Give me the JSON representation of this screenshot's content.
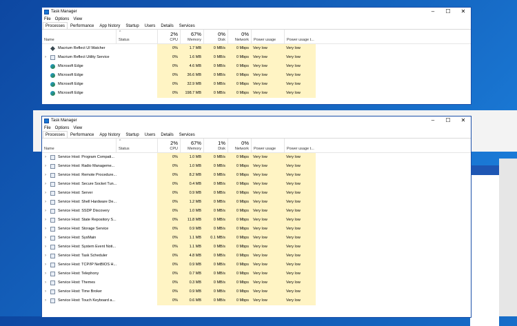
{
  "window1": {
    "title": "Task Manager",
    "menu": [
      "File",
      "Options",
      "View"
    ],
    "tabs": [
      "Processes",
      "Performance",
      "App history",
      "Startup",
      "Users",
      "Details",
      "Services"
    ],
    "active_tab": "Processes",
    "columns": {
      "name": "Name",
      "status": "Status",
      "cpu": {
        "pct": "2%",
        "label": "CPU"
      },
      "memory": {
        "pct": "67%",
        "label": "Memory"
      },
      "disk": {
        "pct": "0%",
        "label": "Disk"
      },
      "network": {
        "pct": "0%",
        "label": "Network"
      },
      "power": "Power usage",
      "power_trend": "Power usage t..."
    },
    "rows": [
      {
        "expand": "",
        "icon": "macrium-icon",
        "name": "Macrium Reflect UI Watcher",
        "cpu": "0%",
        "mem": "1.7 MB",
        "disk": "0 MB/s",
        "net": "0 Mbps",
        "power": "Very low",
        "trend": "Very low"
      },
      {
        "expand": "›",
        "icon": "service-icon",
        "name": "Macrium Reflect Utility Service",
        "cpu": "0%",
        "mem": "1.6 MB",
        "disk": "0 MB/s",
        "net": "0 Mbps",
        "power": "Very low",
        "trend": "Very low"
      },
      {
        "expand": "",
        "icon": "edge-icon",
        "name": "Microsoft Edge",
        "cpu": "0%",
        "mem": "4.6 MB",
        "disk": "0 MB/s",
        "net": "0 Mbps",
        "power": "Very low",
        "trend": "Very low"
      },
      {
        "expand": "",
        "icon": "edge-icon",
        "name": "Microsoft Edge",
        "cpu": "0%",
        "mem": "36.6 MB",
        "disk": "0 MB/s",
        "net": "0 Mbps",
        "power": "Very low",
        "trend": "Very low"
      },
      {
        "expand": "",
        "icon": "edge-icon",
        "name": "Microsoft Edge",
        "cpu": "0%",
        "mem": "32.9 MB",
        "disk": "0 MB/s",
        "net": "0 Mbps",
        "power": "Very low",
        "trend": "Very low"
      },
      {
        "expand": "",
        "icon": "edge-icon",
        "name": "Microsoft Edge",
        "cpu": "0%",
        "mem": "198.7 MB",
        "disk": "0 MB/s",
        "net": "0 Mbps",
        "power": "Very low",
        "trend": "Very low"
      }
    ]
  },
  "window2": {
    "title": "Task Manager",
    "menu": [
      "File",
      "Options",
      "View"
    ],
    "tabs": [
      "Processes",
      "Performance",
      "App history",
      "Startup",
      "Users",
      "Details",
      "Services"
    ],
    "active_tab": "Processes",
    "columns": {
      "name": "Name",
      "status": "Status",
      "cpu": {
        "pct": "2%",
        "label": "CPU"
      },
      "memory": {
        "pct": "67%",
        "label": "Memory"
      },
      "disk": {
        "pct": "1%",
        "label": "Disk"
      },
      "network": {
        "pct": "0%",
        "label": "Network"
      },
      "power": "Power usage",
      "power_trend": "Power usage t..."
    },
    "rows": [
      {
        "expand": "›",
        "icon": "service-icon",
        "name": "Service Host: Program Compati...",
        "cpu": "0%",
        "mem": "1.0 MB",
        "disk": "0 MB/s",
        "net": "0 Mbps",
        "power": "Very low",
        "trend": "Very low"
      },
      {
        "expand": "›",
        "icon": "service-icon",
        "name": "Service Host: Radio Manageme...",
        "cpu": "0%",
        "mem": "1.0 MB",
        "disk": "0 MB/s",
        "net": "0 Mbps",
        "power": "Very low",
        "trend": "Very low"
      },
      {
        "expand": "›",
        "icon": "service-icon",
        "name": "Service Host: Remote Procedure...",
        "cpu": "0%",
        "mem": "8.2 MB",
        "disk": "0 MB/s",
        "net": "0 Mbps",
        "power": "Very low",
        "trend": "Very low"
      },
      {
        "expand": "›",
        "icon": "service-icon",
        "name": "Service Host: Secure Socket Tun...",
        "cpu": "0%",
        "mem": "0.4 MB",
        "disk": "0 MB/s",
        "net": "0 Mbps",
        "power": "Very low",
        "trend": "Very low"
      },
      {
        "expand": "›",
        "icon": "service-icon",
        "name": "Service Host: Server",
        "cpu": "0%",
        "mem": "0.9 MB",
        "disk": "0 MB/s",
        "net": "0 Mbps",
        "power": "Very low",
        "trend": "Very low"
      },
      {
        "expand": "›",
        "icon": "service-icon",
        "name": "Service Host: Shell Hardware De...",
        "cpu": "0%",
        "mem": "1.2 MB",
        "disk": "0 MB/s",
        "net": "0 Mbps",
        "power": "Very low",
        "trend": "Very low"
      },
      {
        "expand": "›",
        "icon": "service-icon",
        "name": "Service Host: SSDP Discovery",
        "cpu": "0%",
        "mem": "1.0 MB",
        "disk": "0 MB/s",
        "net": "0 Mbps",
        "power": "Very low",
        "trend": "Very low"
      },
      {
        "expand": "›",
        "icon": "service-icon",
        "name": "Service Host: State Repository S...",
        "cpu": "0%",
        "mem": "11.8 MB",
        "disk": "0 MB/s",
        "net": "0 Mbps",
        "power": "Very low",
        "trend": "Very low"
      },
      {
        "expand": "›",
        "icon": "service-icon",
        "name": "Service Host: Storage Service",
        "cpu": "0%",
        "mem": "0.9 MB",
        "disk": "0 MB/s",
        "net": "0 Mbps",
        "power": "Very low",
        "trend": "Very low"
      },
      {
        "expand": "›",
        "icon": "service-icon",
        "name": "Service Host: SysMain",
        "cpu": "0%",
        "mem": "1.1 MB",
        "disk": "0.1 MB/s",
        "net": "0 Mbps",
        "power": "Very low",
        "trend": "Very low"
      },
      {
        "expand": "›",
        "icon": "service-icon",
        "name": "Service Host: System Event Noti...",
        "cpu": "0%",
        "mem": "1.1 MB",
        "disk": "0 MB/s",
        "net": "0 Mbps",
        "power": "Very low",
        "trend": "Very low"
      },
      {
        "expand": "›",
        "icon": "service-icon",
        "name": "Service Host: Task Scheduler",
        "cpu": "0%",
        "mem": "4.8 MB",
        "disk": "0 MB/s",
        "net": "0 Mbps",
        "power": "Very low",
        "trend": "Very low"
      },
      {
        "expand": "›",
        "icon": "service-icon",
        "name": "Service Host: TCP/IP NetBIOS H...",
        "cpu": "0%",
        "mem": "0.9 MB",
        "disk": "0 MB/s",
        "net": "0 Mbps",
        "power": "Very low",
        "trend": "Very low"
      },
      {
        "expand": "›",
        "icon": "service-icon",
        "name": "Service Host: Telephony",
        "cpu": "0%",
        "mem": "0.7 MB",
        "disk": "0 MB/s",
        "net": "0 Mbps",
        "power": "Very low",
        "trend": "Very low"
      },
      {
        "expand": "›",
        "icon": "service-icon",
        "name": "Service Host: Themes",
        "cpu": "0%",
        "mem": "0.3 MB",
        "disk": "0 MB/s",
        "net": "0 Mbps",
        "power": "Very low",
        "trend": "Very low"
      },
      {
        "expand": "›",
        "icon": "service-icon",
        "name": "Service Host: Time Broker",
        "cpu": "0%",
        "mem": "0.9 MB",
        "disk": "0 MB/s",
        "net": "0 Mbps",
        "power": "Very low",
        "trend": "Very low"
      },
      {
        "expand": "›",
        "icon": "service-icon",
        "name": "Service Host: Touch Keyboard a...",
        "cpu": "0%",
        "mem": "0.6 MB",
        "disk": "0 MB/s",
        "net": "0 Mbps",
        "power": "Very low",
        "trend": "Very low"
      }
    ]
  },
  "window_controls": {
    "minimize": "–",
    "maximize": "☐",
    "close": "✕"
  },
  "colors": {
    "highlight": "#fff4c4",
    "titlebar_border": "#1a4fa8"
  }
}
